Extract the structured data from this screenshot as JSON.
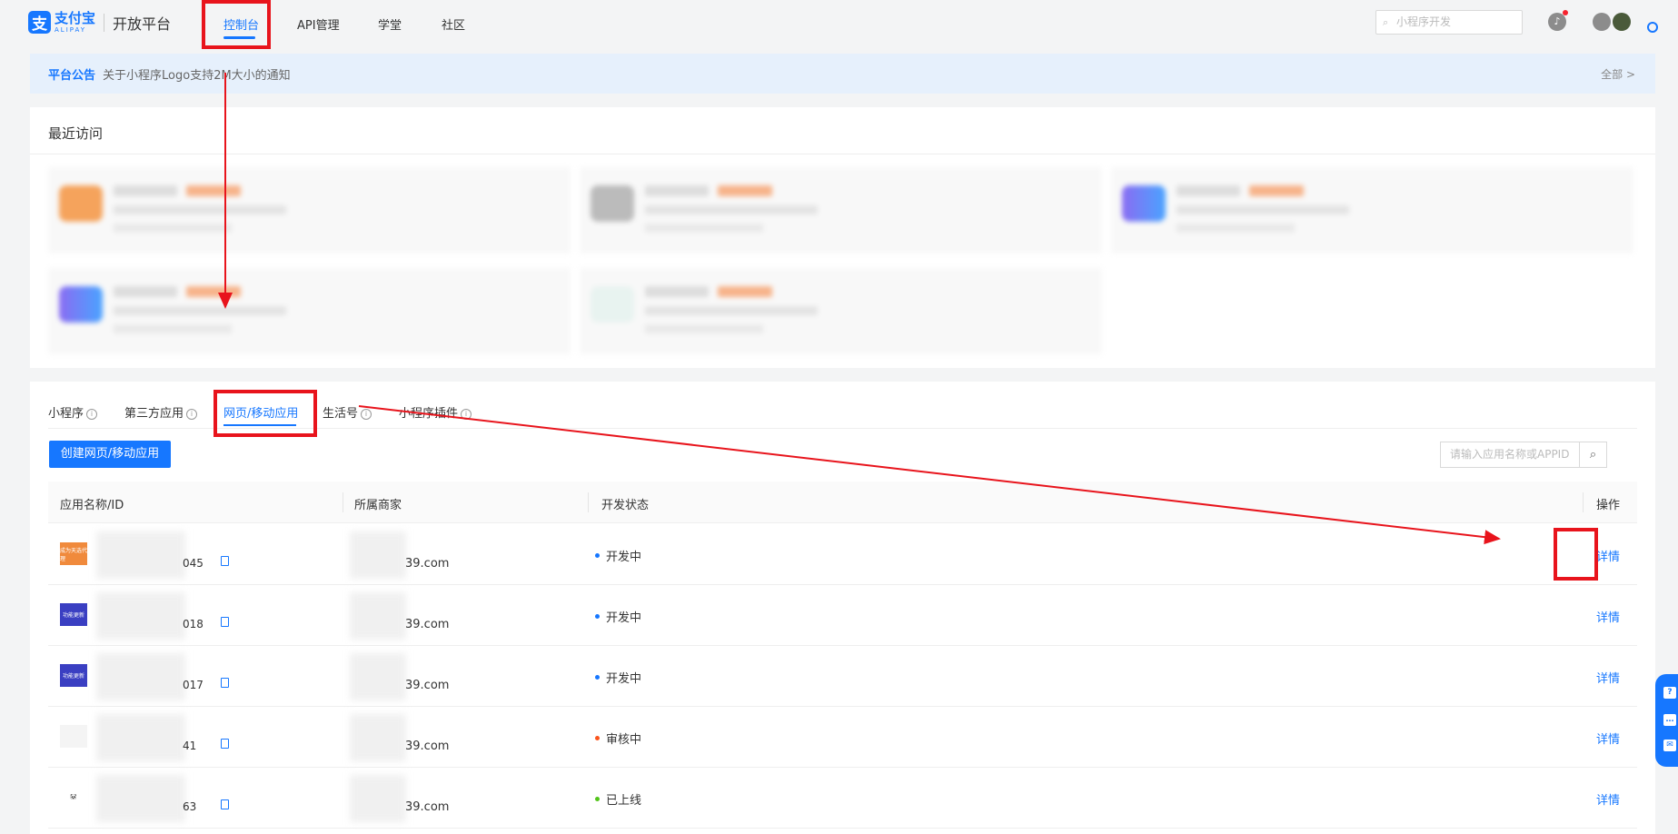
{
  "header": {
    "logo_cn": "支付宝",
    "logo_en": "ALIPAY",
    "platform": "开放平台",
    "nav": [
      "控制台",
      "API管理",
      "学堂",
      "社区"
    ],
    "search_placeholder": "小程序开发"
  },
  "notice": {
    "tag": "平台公告",
    "text": "关于小程序Logo支持2M大小的通知",
    "all": "全部 >"
  },
  "recent": {
    "title": "最近访问"
  },
  "apps": {
    "tabs": [
      "小程序",
      "第三方应用",
      "网页/移动应用",
      "生活号",
      "小程序插件"
    ],
    "active_tab": "网页/移动应用",
    "create_button": "创建网页/移动应用",
    "search_placeholder": "请输入应用名称或APPID",
    "columns": [
      "应用名称/ID",
      "所属商家",
      "开发状态",
      "操作"
    ],
    "rows": [
      {
        "id_suffix": "045",
        "merchant": "39.com",
        "status": "开发中",
        "status_color": "#1677ff",
        "action": "详情",
        "thumb_color": "#f08a3c",
        "thumb_text": "成为天选代理"
      },
      {
        "id_suffix": "018",
        "merchant": "39.com",
        "status": "开发中",
        "status_color": "#1677ff",
        "action": "详情",
        "thumb_color": "#3a3fc2",
        "thumb_text": "功能更新"
      },
      {
        "id_suffix": "017",
        "merchant": "39.com",
        "status": "开发中",
        "status_color": "#1677ff",
        "action": "详情",
        "thumb_color": "#3a3fc2",
        "thumb_text": "功能更新"
      },
      {
        "id_suffix": "41",
        "merchant": "39.com",
        "status": "审核中",
        "status_color": "#fa541c",
        "action": "详情",
        "thumb_color": "#f4f4f4",
        "thumb_text": ""
      },
      {
        "id_suffix": "63",
        "merchant": "39.com",
        "status": "已上线",
        "status_color": "#52c41a",
        "action": "详情",
        "thumb_color": "#ffffff",
        "thumb_text": "🐼"
      }
    ]
  }
}
